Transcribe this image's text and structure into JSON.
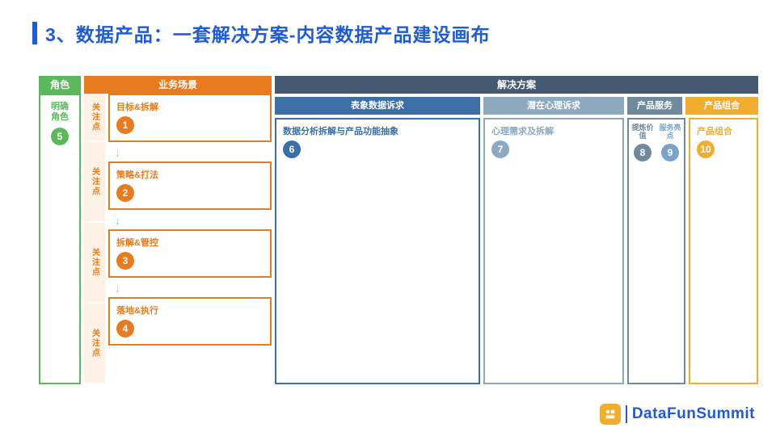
{
  "title": "3、数据产品：一套解决方案-内容数据产品建设画布",
  "columns": {
    "role": {
      "header": "角色",
      "label": "明确\n角色",
      "num": "5"
    },
    "scenario": {
      "header": "业务场景",
      "focus_label": "关注点",
      "items": [
        {
          "title": "目标&拆解",
          "num": "1"
        },
        {
          "title": "策略&打法",
          "num": "2"
        },
        {
          "title": "拆解&管控",
          "num": "3"
        },
        {
          "title": "落地&执行",
          "num": "4"
        }
      ]
    },
    "solution": {
      "header": "解决方案",
      "sub": {
        "a": {
          "header": "表象数据诉求",
          "title": "数据分析拆解与产品功能抽象",
          "num": "6"
        },
        "b": {
          "header": "潜在心理诉求",
          "title": "心理需求及拆解",
          "num": "7"
        },
        "c": {
          "header": "产品服务",
          "left": {
            "label": "提炼价值",
            "num": "8"
          },
          "right": {
            "label": "服务亮点",
            "num": "9"
          }
        },
        "d": {
          "header": "产品组合",
          "title": "产品组合",
          "num": "10"
        }
      }
    }
  },
  "brand": "DataFunSummit"
}
